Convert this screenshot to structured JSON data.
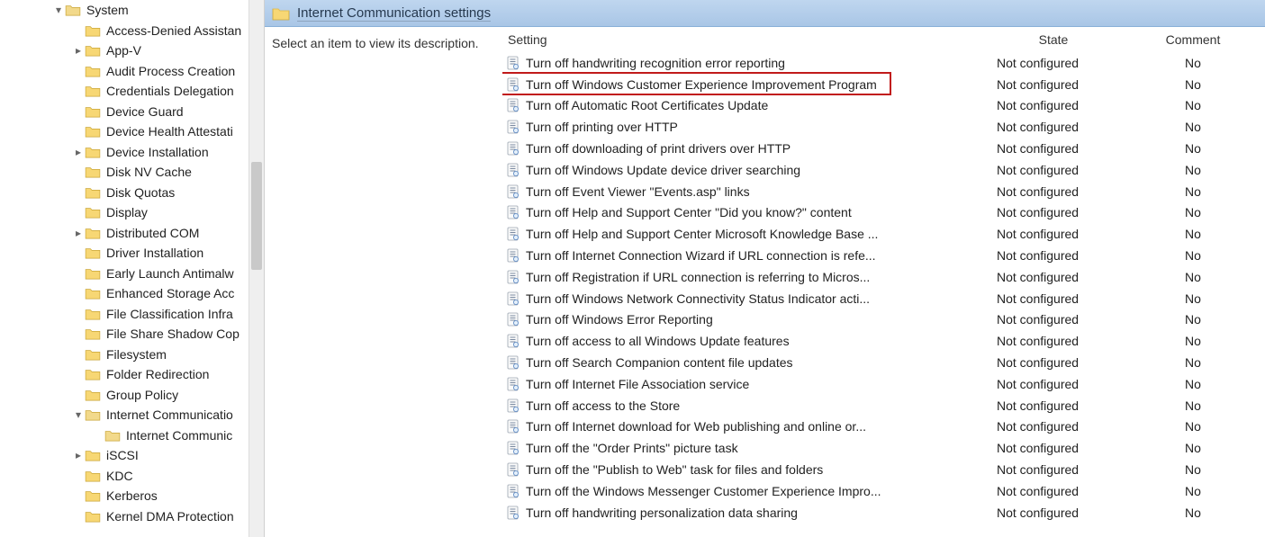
{
  "header": {
    "title": "Internet Communication settings"
  },
  "description_placeholder": "Select an item to view its description.",
  "columns": {
    "setting": "Setting",
    "state": "State",
    "comment": "Comment"
  },
  "tree": [
    {
      "indent": 2,
      "caret": "expanded",
      "label": "System"
    },
    {
      "indent": 3,
      "caret": "",
      "label": "Access-Denied Assistan"
    },
    {
      "indent": 3,
      "caret": "collapsed",
      "label": "App-V"
    },
    {
      "indent": 3,
      "caret": "",
      "label": "Audit Process Creation"
    },
    {
      "indent": 3,
      "caret": "",
      "label": "Credentials Delegation"
    },
    {
      "indent": 3,
      "caret": "",
      "label": "Device Guard"
    },
    {
      "indent": 3,
      "caret": "",
      "label": "Device Health Attestati"
    },
    {
      "indent": 3,
      "caret": "collapsed",
      "label": "Device Installation"
    },
    {
      "indent": 3,
      "caret": "",
      "label": "Disk NV Cache"
    },
    {
      "indent": 3,
      "caret": "",
      "label": "Disk Quotas"
    },
    {
      "indent": 3,
      "caret": "",
      "label": "Display"
    },
    {
      "indent": 3,
      "caret": "collapsed",
      "label": "Distributed COM"
    },
    {
      "indent": 3,
      "caret": "",
      "label": "Driver Installation"
    },
    {
      "indent": 3,
      "caret": "",
      "label": "Early Launch Antimalw"
    },
    {
      "indent": 3,
      "caret": "",
      "label": "Enhanced Storage Acc"
    },
    {
      "indent": 3,
      "caret": "",
      "label": "File Classification Infra"
    },
    {
      "indent": 3,
      "caret": "",
      "label": "File Share Shadow Cop"
    },
    {
      "indent": 3,
      "caret": "",
      "label": "Filesystem"
    },
    {
      "indent": 3,
      "caret": "",
      "label": "Folder Redirection"
    },
    {
      "indent": 3,
      "caret": "",
      "label": "Group Policy"
    },
    {
      "indent": 3,
      "caret": "expanded",
      "label": "Internet Communicatio"
    },
    {
      "indent": 4,
      "caret": "",
      "label": "Internet Communic",
      "selected": true
    },
    {
      "indent": 3,
      "caret": "collapsed",
      "label": "iSCSI"
    },
    {
      "indent": 3,
      "caret": "",
      "label": "KDC"
    },
    {
      "indent": 3,
      "caret": "",
      "label": "Kerberos"
    },
    {
      "indent": 3,
      "caret": "",
      "label": "Kernel DMA Protection"
    }
  ],
  "settings": [
    {
      "name": "Turn off handwriting recognition error reporting",
      "state": "Not configured",
      "comment": "No"
    },
    {
      "name": "Turn off Windows Customer Experience Improvement Program",
      "state": "Not configured",
      "comment": "No",
      "highlighted": true
    },
    {
      "name": "Turn off Automatic Root Certificates Update",
      "state": "Not configured",
      "comment": "No"
    },
    {
      "name": "Turn off printing over HTTP",
      "state": "Not configured",
      "comment": "No"
    },
    {
      "name": "Turn off downloading of print drivers over HTTP",
      "state": "Not configured",
      "comment": "No"
    },
    {
      "name": "Turn off Windows Update device driver searching",
      "state": "Not configured",
      "comment": "No"
    },
    {
      "name": "Turn off Event Viewer \"Events.asp\" links",
      "state": "Not configured",
      "comment": "No"
    },
    {
      "name": "Turn off Help and Support Center \"Did you know?\" content",
      "state": "Not configured",
      "comment": "No"
    },
    {
      "name": "Turn off Help and Support Center Microsoft Knowledge Base ...",
      "state": "Not configured",
      "comment": "No"
    },
    {
      "name": "Turn off Internet Connection Wizard if URL connection is refe...",
      "state": "Not configured",
      "comment": "No"
    },
    {
      "name": "Turn off Registration if URL connection is referring to Micros...",
      "state": "Not configured",
      "comment": "No"
    },
    {
      "name": "Turn off Windows Network Connectivity Status Indicator acti...",
      "state": "Not configured",
      "comment": "No"
    },
    {
      "name": "Turn off Windows Error Reporting",
      "state": "Not configured",
      "comment": "No"
    },
    {
      "name": "Turn off access to all Windows Update features",
      "state": "Not configured",
      "comment": "No"
    },
    {
      "name": "Turn off Search Companion content file updates",
      "state": "Not configured",
      "comment": "No"
    },
    {
      "name": "Turn off Internet File Association service",
      "state": "Not configured",
      "comment": "No"
    },
    {
      "name": "Turn off access to the Store",
      "state": "Not configured",
      "comment": "No"
    },
    {
      "name": "Turn off Internet download for Web publishing and online or...",
      "state": "Not configured",
      "comment": "No"
    },
    {
      "name": "Turn off the \"Order Prints\" picture task",
      "state": "Not configured",
      "comment": "No"
    },
    {
      "name": "Turn off the \"Publish to Web\" task for files and folders",
      "state": "Not configured",
      "comment": "No"
    },
    {
      "name": "Turn off the Windows Messenger Customer Experience Impro...",
      "state": "Not configured",
      "comment": "No"
    },
    {
      "name": "Turn off handwriting personalization data sharing",
      "state": "Not configured",
      "comment": "No"
    }
  ]
}
